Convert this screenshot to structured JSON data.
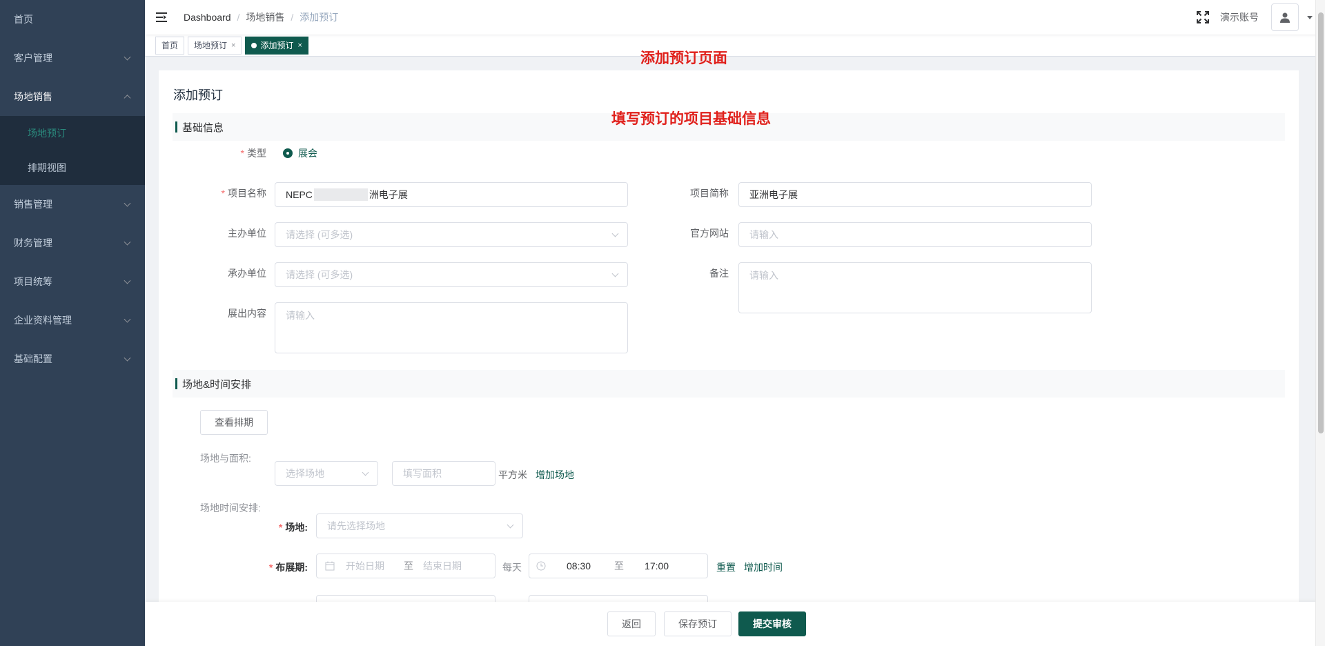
{
  "sidebar": {
    "items": [
      {
        "label": "首页"
      },
      {
        "label": "客户管理"
      },
      {
        "label": "场地销售"
      },
      {
        "label": "销售管理"
      },
      {
        "label": "财务管理"
      },
      {
        "label": "项目统筹"
      },
      {
        "label": "企业资料管理"
      },
      {
        "label": "基础配置"
      }
    ],
    "submenu": [
      {
        "label": "场地预订"
      },
      {
        "label": "排期视图"
      }
    ]
  },
  "header": {
    "breadcrumb": [
      "Dashboard",
      "场地销售",
      "添加预订"
    ],
    "account_name": "演示账号"
  },
  "tags": [
    {
      "label": "首页"
    },
    {
      "label": "场地预订"
    },
    {
      "label": "添加预订"
    }
  ],
  "annotations": {
    "page": "添加预订页面",
    "section": "填写预订的项目基础信息"
  },
  "form": {
    "title": "添加预订",
    "section_basic": "基础信息",
    "type_label": "类型",
    "type_value": "展会",
    "project_name_label": "项目名称",
    "project_name_prefix": "NEPC",
    "project_name_suffix": "洲电子展",
    "project_short_label": "项目简称",
    "project_short_value": "亚洲电子展",
    "organizer_label": "主办单位",
    "organizer_placeholder": "请选择 (可多选)",
    "website_label": "官方网站",
    "website_placeholder": "请输入",
    "contractor_label": "承办单位",
    "contractor_placeholder": "请选择 (可多选)",
    "remark_label": "备注",
    "remark_placeholder": "请输入",
    "exhibit_label": "展出内容",
    "exhibit_placeholder": "请输入",
    "section_venue": "场地&时间安排",
    "view_schedule_button": "查看排期",
    "venue_area_label": "场地与面积:",
    "venue_select_placeholder": "选择场地",
    "area_placeholder": "填写面积",
    "area_unit": "平方米",
    "add_venue_link": "增加场地",
    "venue_time_label": "场地时间安排:",
    "venue_label": "场地:",
    "venue_first_placeholder": "请先选择场地",
    "setup_label": "布展期:",
    "start_date_placeholder": "开始日期",
    "date_to": "至",
    "end_date_placeholder": "结束日期",
    "daily_label": "每天",
    "time_start": "08:30",
    "time_to": "至",
    "time_end": "17:00",
    "reset_link": "重置",
    "add_time_link": "增加时间"
  },
  "footer": {
    "back_button": "返回",
    "save_button": "保存预订",
    "submit_button": "提交审核"
  },
  "colors": {
    "primary": "#0f5a4e",
    "sidebar_bg": "#304156",
    "submenu_bg": "#1f2d3d",
    "annotation_red": "#e0201b"
  }
}
